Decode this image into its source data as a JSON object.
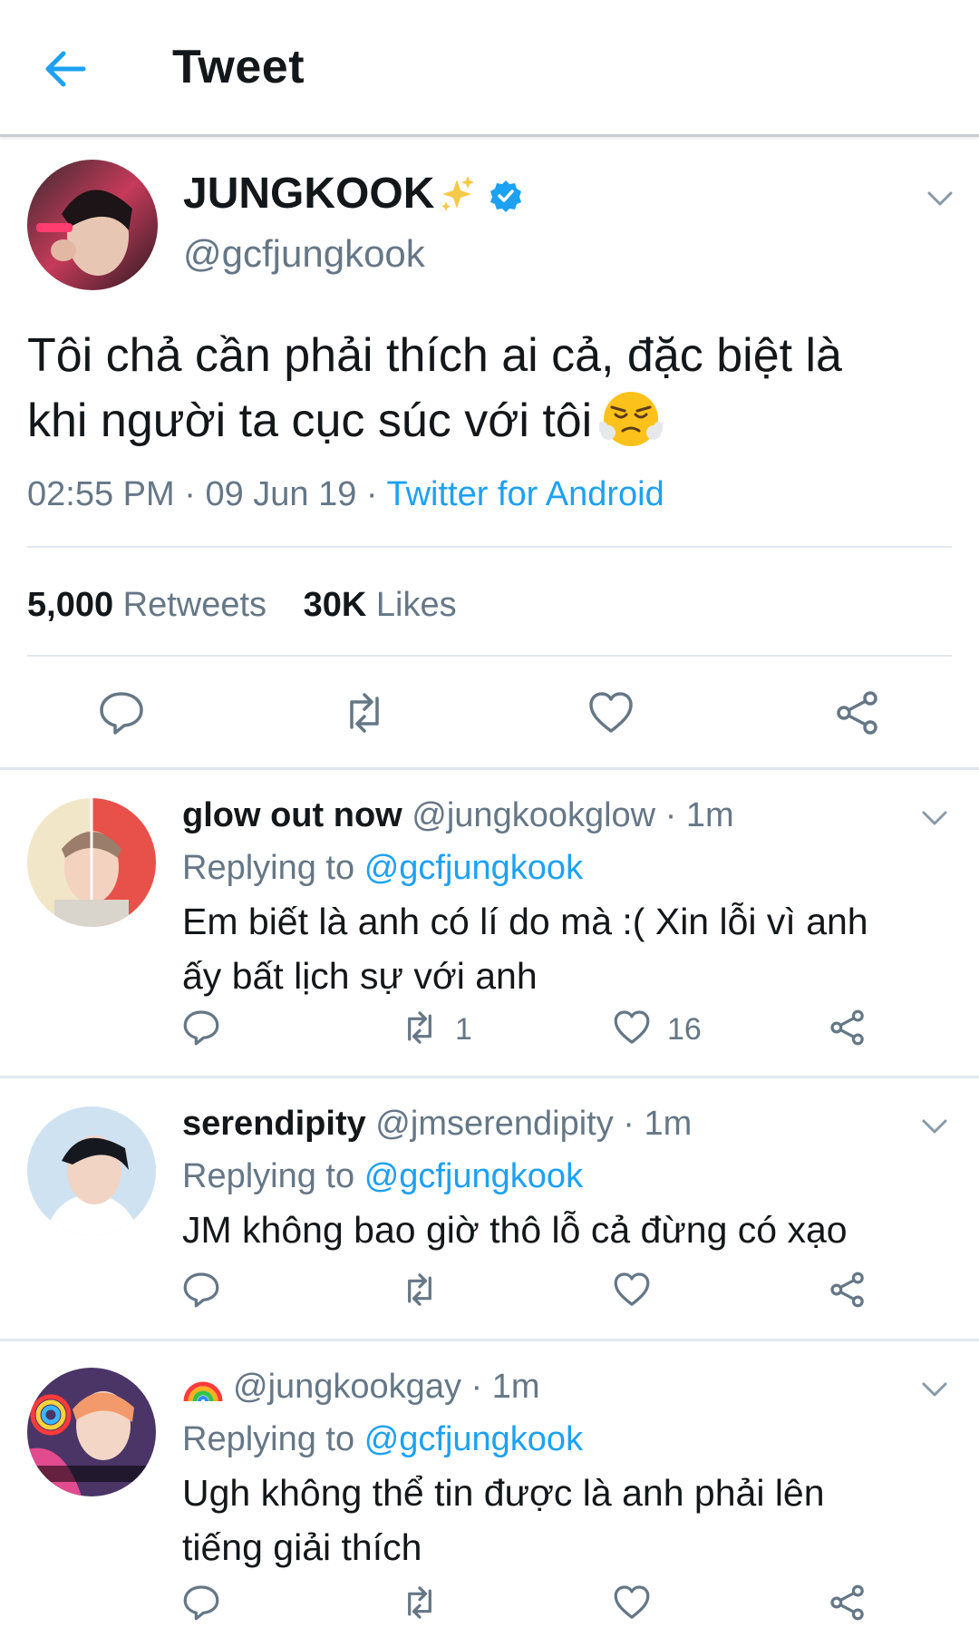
{
  "header": {
    "title": "Tweet",
    "back_icon": "arrow-left-icon"
  },
  "colors": {
    "accent": "#1da1f2",
    "secondary_text": "#657786",
    "text": "#14171a",
    "divider": "#e1e8ed"
  },
  "tweet": {
    "name": "JUNGKOOK",
    "handle": "@gcfjungkook",
    "text_line1": "Tôi chả cần phải thích ai cả, đặc biệt là",
    "text_line2": "khi người ta cục súc với tôi",
    "emoji": "face-with-steam-from-nose",
    "time": "02:55 PM",
    "date": "09 Jun 19",
    "dot": "·",
    "source": "Twitter for Android",
    "retweets_count": "5,000",
    "retweets_label": "Retweets",
    "likes_count": "30K",
    "likes_label": "Likes"
  },
  "replies": [
    {
      "name": "glow out now",
      "handle": "@jungkookglow",
      "time": "· 1m",
      "replying_label": "Replying to",
      "replying_to": "@gcfjungkook",
      "text_line1": "Em biết là anh có lí do mà :( Xin lỗi vì anh",
      "text_line2": "ấy bất lịch sự với anh",
      "retweets": "1",
      "likes": "16"
    },
    {
      "name": "serendipity",
      "handle": "@jmserendipity",
      "time": "· 1m",
      "replying_label": "Replying to",
      "replying_to": "@gcfjungkook",
      "text_line1": "JM không bao giờ thô lỗ cả đừng có xạo",
      "retweets": "",
      "likes": ""
    },
    {
      "name_emoji": "rainbow",
      "handle": "@jungkookgay",
      "time": "· 1m",
      "replying_label": "Replying to",
      "replying_to": "@gcfjungkook",
      "text_line1": "Ugh không thể tin được là anh phải lên",
      "text_line2": "tiếng giải thích",
      "retweets": "",
      "likes": ""
    }
  ]
}
